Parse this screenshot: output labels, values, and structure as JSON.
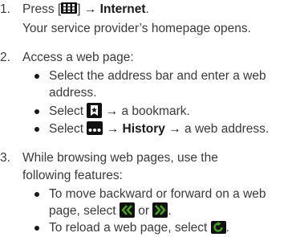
{
  "steps": [
    {
      "number": "1.",
      "lines": [
        {
          "pre": "Press [",
          "icon": "grid-menu-icon",
          "mid": "] ",
          "arrow": "→",
          "strong": "Internet",
          "post": "."
        },
        {
          "text": "Your service provider’s homepage opens."
        }
      ]
    },
    {
      "number": "2.",
      "intro": "Access a web page:",
      "bullets": [
        {
          "line1": "Select the address bar and enter a web",
          "line2": "address."
        },
        {
          "pre": "Select ",
          "icon": "bookmark-star-icon",
          "arrow": "→",
          "post": " a bookmark."
        },
        {
          "pre": "Select ",
          "icon": "more-dots-icon",
          "arrow": "→",
          "strong": "History",
          "arrow2": "→",
          "post": " a web address."
        }
      ]
    },
    {
      "number": "3.",
      "intro_line1": "While browsing web pages, use the",
      "intro_line2": "following features:",
      "bullets": [
        {
          "line1": "To move backward or forward on a web",
          "line2_pre": "page, select ",
          "icon_back": "back-chevrons-icon",
          "or": " or ",
          "icon_fwd": "forward-chevrons-icon",
          "line2_post": "."
        },
        {
          "pre": "To reload a web page, select ",
          "icon": "reload-icon",
          "post": "."
        }
      ]
    }
  ],
  "colors": {
    "text": "#3a3a3a",
    "icon_bg": "#111111",
    "icon_fg": "#ffffff",
    "accent_green": "#4a9c2a"
  }
}
